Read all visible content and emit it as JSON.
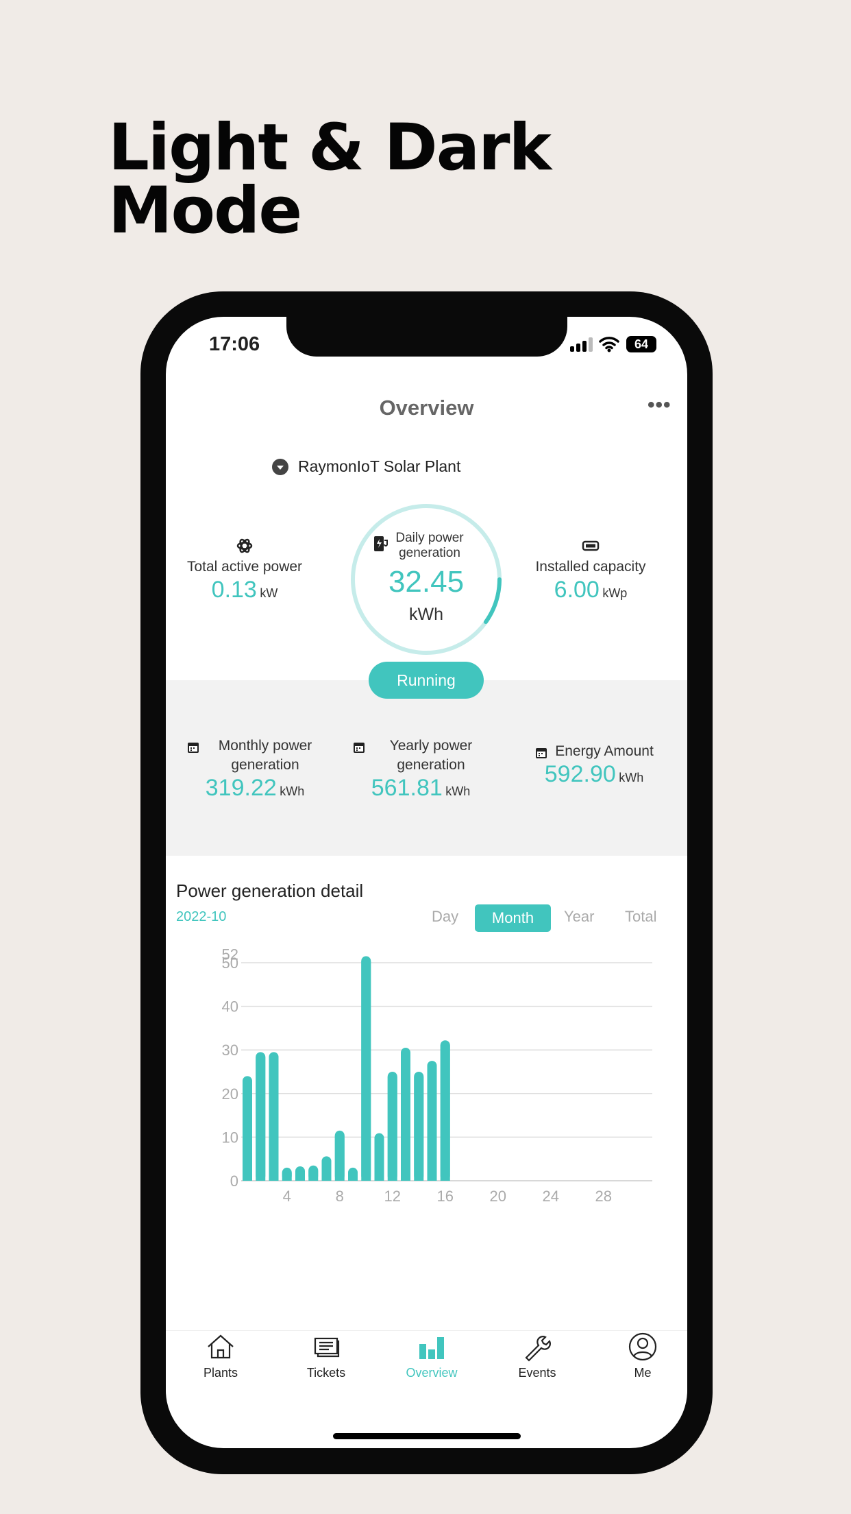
{
  "headline": [
    "Light & Dark",
    "Mode"
  ],
  "status": {
    "time": "17:06",
    "battery": "64"
  },
  "header": {
    "title": "Overview",
    "more_icon": "ellipsis-icon"
  },
  "plant": {
    "name": "RaymonIoT Solar Plant"
  },
  "metrics": {
    "active": {
      "label": "Total active power",
      "value": "0.13",
      "unit": "kW"
    },
    "daily": {
      "label": "Daily power generation",
      "value": "32.45",
      "unit": "kWh"
    },
    "capacity": {
      "label": "Installed capacity",
      "value": "6.00",
      "unit": "kWp"
    },
    "status": "Running"
  },
  "summary": [
    {
      "label": "Monthly power generation",
      "value": "319.22",
      "unit": "kWh"
    },
    {
      "label": "Yearly power generation",
      "value": "561.81",
      "unit": "kWh"
    },
    {
      "label": "Energy Amount",
      "value": "592.90",
      "unit": "kWh"
    }
  ],
  "detail": {
    "title": "Power generation detail",
    "date": "2022-10",
    "tabs": [
      "Day",
      "Month",
      "Year",
      "Total"
    ],
    "active_tab": "Month"
  },
  "colors": {
    "accent": "#41c5be"
  },
  "chart_data": {
    "type": "bar",
    "x": [
      1,
      2,
      3,
      4,
      5,
      6,
      7,
      8,
      9,
      10,
      11,
      12,
      13,
      14,
      15,
      16
    ],
    "values": [
      24,
      29.5,
      29.5,
      3,
      3.3,
      3.5,
      5.6,
      11.5,
      3,
      51.5,
      10.9,
      25,
      30.5,
      25,
      27.5,
      32.2
    ],
    "xlim": [
      0,
      31
    ],
    "ylim": [
      0,
      52
    ],
    "yticks": [
      0,
      10,
      20,
      30,
      40,
      50,
      52
    ],
    "xticks": [
      4,
      8,
      12,
      16,
      20,
      24,
      28
    ],
    "grid": true
  },
  "nav": [
    {
      "label": "Plants",
      "icon": "home-icon"
    },
    {
      "label": "Tickets",
      "icon": "tickets-icon"
    },
    {
      "label": "Overview",
      "icon": "bar-chart-icon",
      "active": true
    },
    {
      "label": "Events",
      "icon": "wrench-icon"
    },
    {
      "label": "Me",
      "icon": "user-icon"
    }
  ]
}
